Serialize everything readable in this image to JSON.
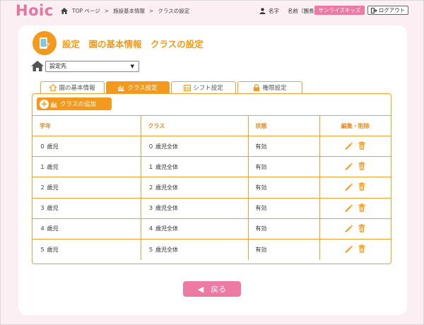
{
  "header": {
    "logo": "Hoic",
    "breadcrumbs": [
      "TOP ページ",
      "施設基本情報",
      "クラスの設定"
    ],
    "breadcrumb_sep": ">",
    "user_label": "名字",
    "user_role": "名前（園長）",
    "nursery_button": "サンライズキッズ",
    "logout_button": "ログアウト"
  },
  "page": {
    "title": "設定　園の基本情報　クラスの設定",
    "select_value": "設定先"
  },
  "tabs": [
    {
      "label": "園の基本情報",
      "icon": "house-icon"
    },
    {
      "label": "クラス設定",
      "icon": "class-icon"
    },
    {
      "label": "シフト設定",
      "icon": "calendar-icon"
    },
    {
      "label": "権限設定",
      "icon": "lock-icon"
    }
  ],
  "active_tab": "クラス設定",
  "add_button": "クラスの追加",
  "table": {
    "headers": [
      "学年",
      "クラス",
      "状態",
      "編集・削除"
    ],
    "rows": [
      [
        "０ 歳児",
        "０ 歳児全体",
        "有効"
      ],
      [
        "１ 歳児",
        "１ 歳児全体",
        "有効"
      ],
      [
        "２ 歳児",
        "２ 歳児全体",
        "有効"
      ],
      [
        "３ 歳児",
        "３ 歳児全体",
        "有効"
      ],
      [
        "４ 歳児",
        "４ 歳児全体",
        "有効"
      ],
      [
        "５ 歳児",
        "５ 歳児全体",
        "有効"
      ]
    ]
  },
  "back_button": "戻る",
  "colors": {
    "accent_orange": "#f39a1e",
    "brand_pink": "#ec7aa3",
    "background": "#fbeff3"
  }
}
